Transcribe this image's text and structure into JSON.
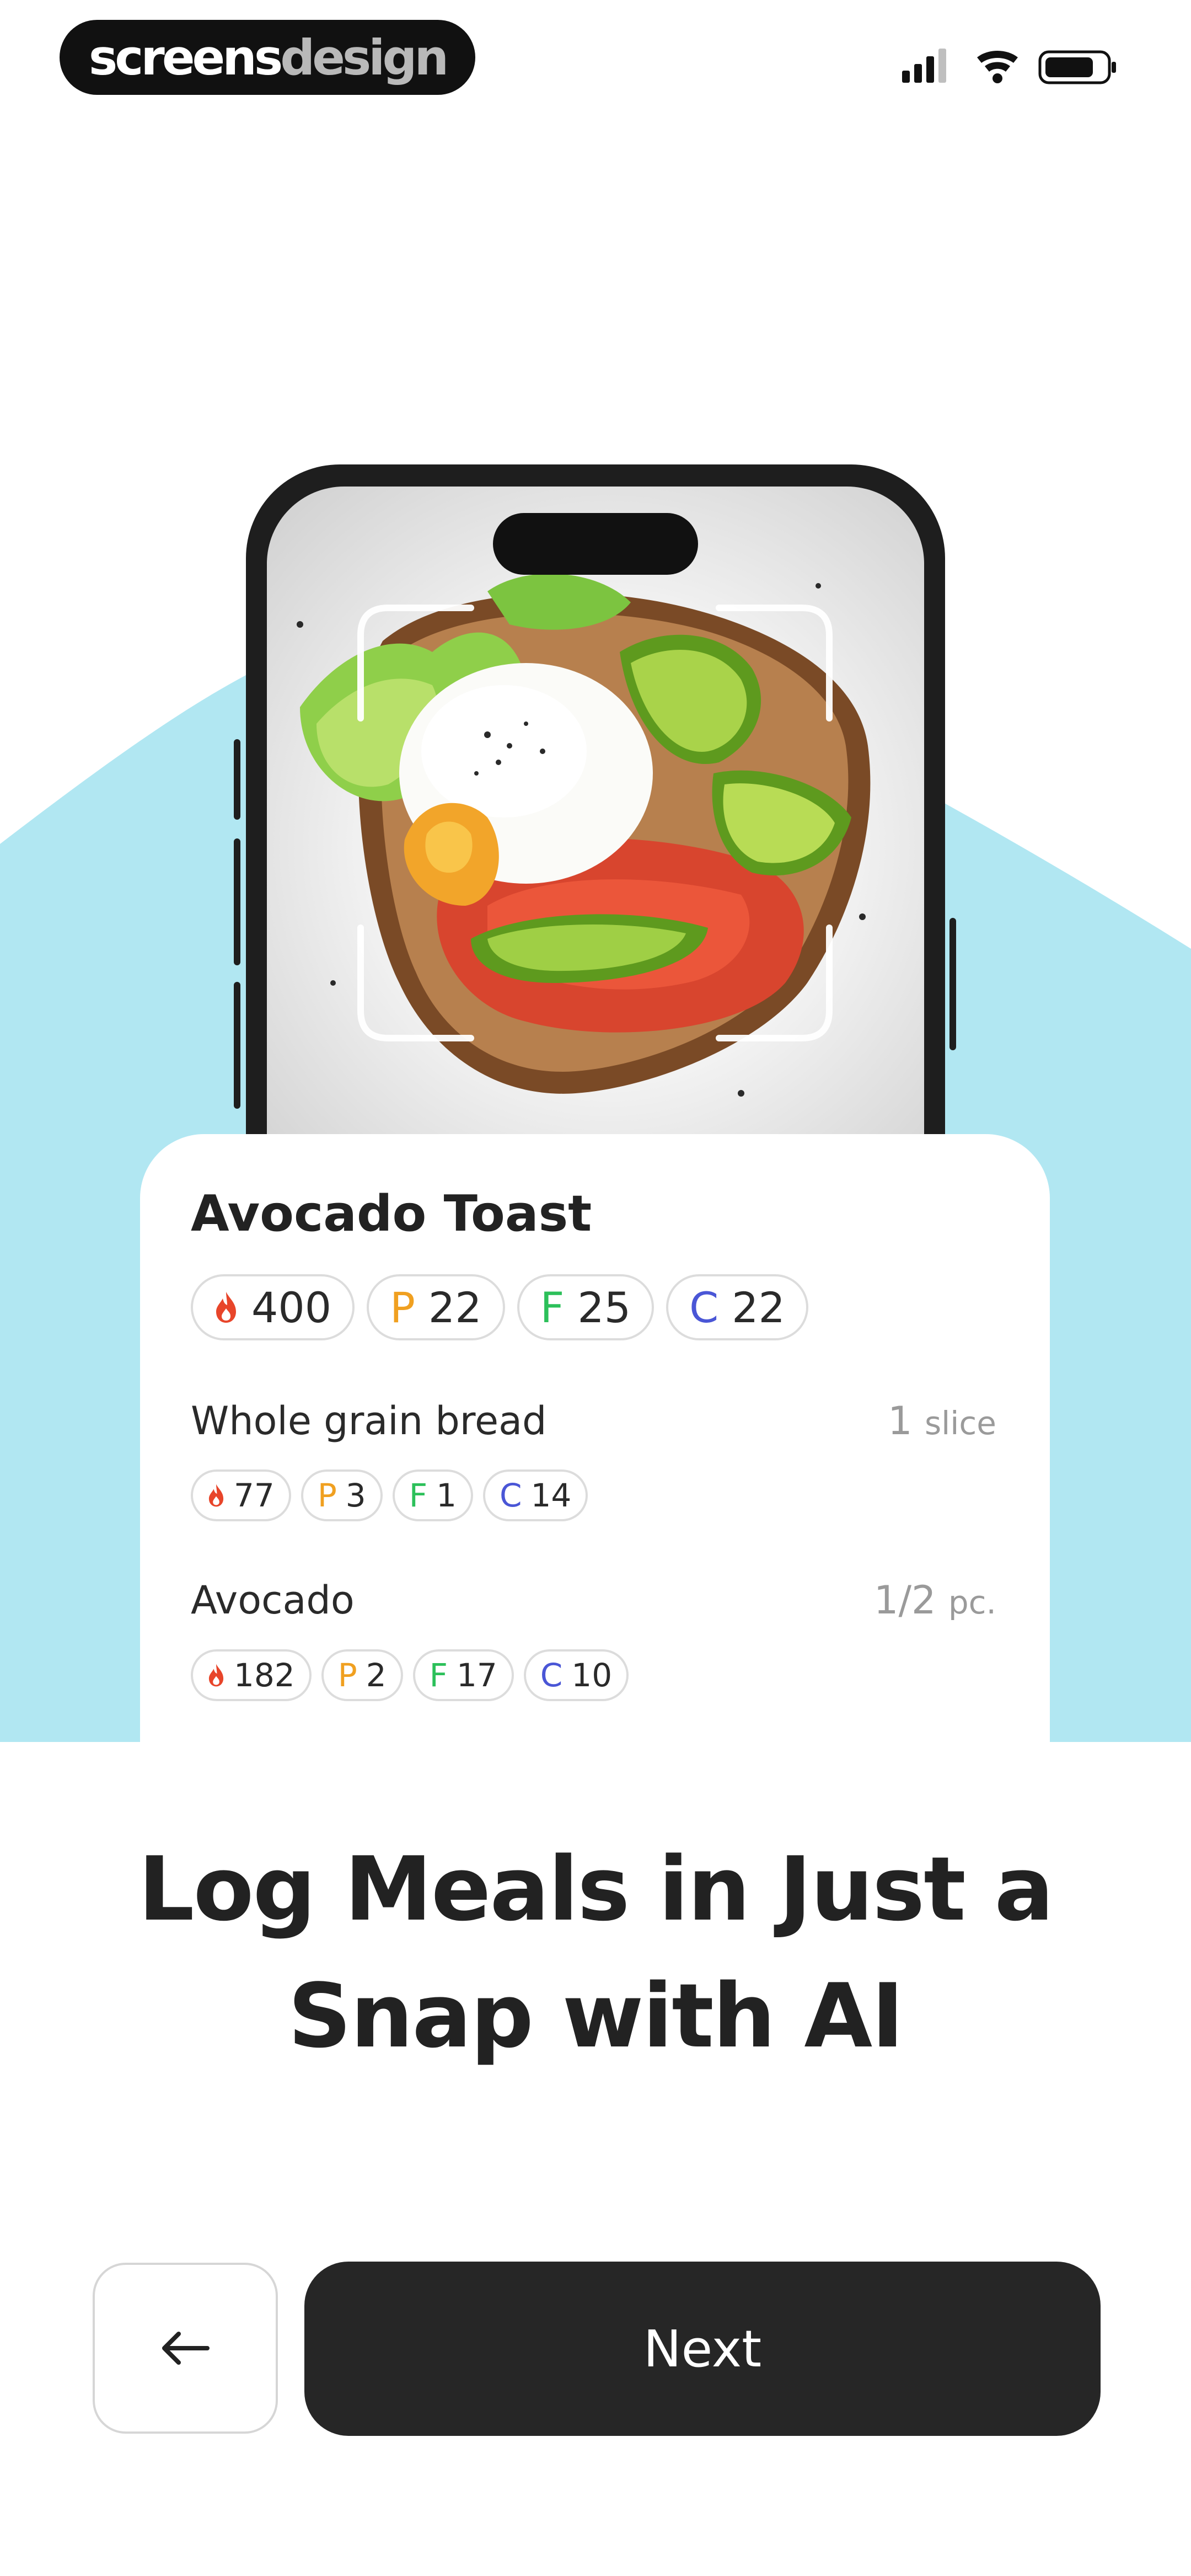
{
  "brand": {
    "part1": "screens",
    "part2": "design"
  },
  "status_bar": {
    "icons": [
      "cellular-signal-icon",
      "wifi-icon",
      "battery-icon"
    ]
  },
  "colors": {
    "backdrop": "#b1e7f2",
    "button_dark": "#262626",
    "flame": "#e8452a",
    "protein": "#f0a020",
    "fat": "#2cc05a",
    "carbs": "#4a56d6"
  },
  "meal": {
    "title": "Avocado Toast",
    "macros": {
      "calories": "400",
      "protein_letter": "P",
      "protein": "22",
      "fat_letter": "F",
      "fat": "25",
      "carbs_letter": "C",
      "carbs": "22"
    }
  },
  "items": [
    {
      "name": "Whole grain bread",
      "qty": "1",
      "unit": "slice",
      "calories": "77",
      "protein": "3",
      "fat": "1",
      "carbs": "14"
    },
    {
      "name": "Avocado",
      "qty": "1/2",
      "unit": "pc.",
      "calories": "182",
      "protein": "2",
      "fat": "17",
      "carbs": "10"
    }
  ],
  "headline": {
    "line1": "Log Meals in Just a",
    "line2": "Snap with AI"
  },
  "buttons": {
    "back_icon": "arrow-left-icon",
    "next_label": "Next"
  }
}
